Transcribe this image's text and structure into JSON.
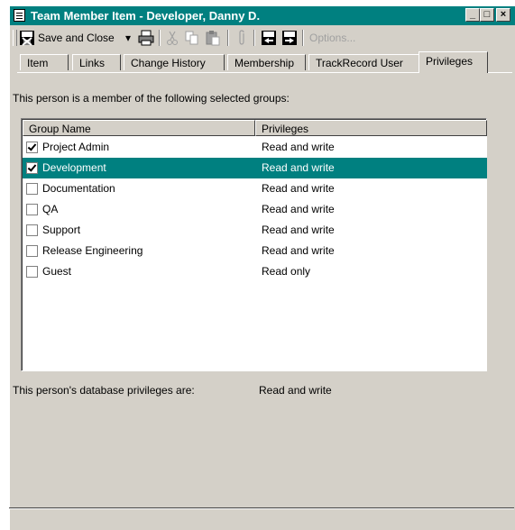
{
  "window": {
    "title": "Team Member Item - Developer, Danny D.",
    "controls": {
      "minimize": "_",
      "maximize": "□",
      "close": "×"
    }
  },
  "toolbar": {
    "save_close_label": "Save and Close",
    "dropdown_arrow": "▾",
    "options_label": "Options..."
  },
  "tabs": [
    {
      "label": "Item"
    },
    {
      "label": "Links"
    },
    {
      "label": "Change History"
    },
    {
      "label": "Membership"
    },
    {
      "label": "TrackRecord User"
    },
    {
      "label": "Privileges",
      "active": true
    }
  ],
  "intro_text": "This person is a member of the following selected groups:",
  "list": {
    "columns": [
      "Group Name",
      "Privileges"
    ],
    "rows": [
      {
        "name": "Project Admin",
        "privileges": "Read and write",
        "checked": true,
        "selected": false
      },
      {
        "name": "Development",
        "privileges": "Read and write",
        "checked": true,
        "selected": true
      },
      {
        "name": "Documentation",
        "privileges": "Read and write",
        "checked": false,
        "selected": false
      },
      {
        "name": "QA",
        "privileges": "Read and write",
        "checked": false,
        "selected": false
      },
      {
        "name": "Support",
        "privileges": "Read and write",
        "checked": false,
        "selected": false
      },
      {
        "name": "Release Engineering",
        "privileges": "Read and write",
        "checked": false,
        "selected": false
      },
      {
        "name": "Guest",
        "privileges": "Read only",
        "checked": false,
        "selected": false
      }
    ]
  },
  "footer": {
    "label": "This person's database privileges are:",
    "value": "Read and write"
  },
  "colors": {
    "titlebar": "#008080",
    "selection": "#008080",
    "face": "#d4d0c8"
  }
}
